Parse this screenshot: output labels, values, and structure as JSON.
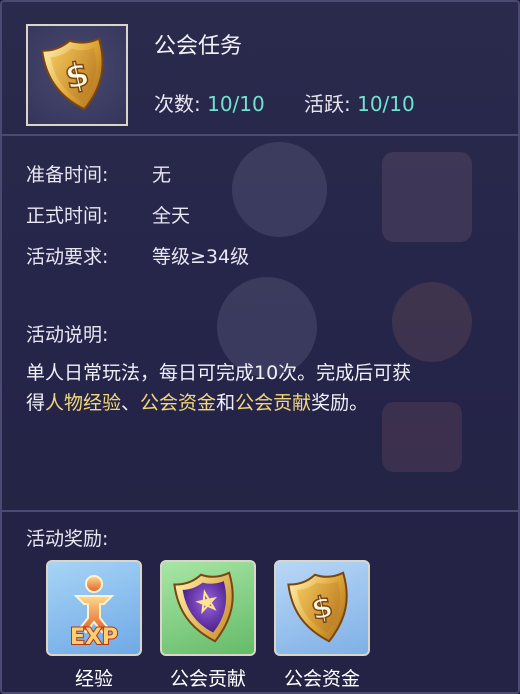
{
  "task": {
    "title": "公会任务",
    "count_label": "次数:",
    "count_value": "10/10",
    "active_label": "活跃:",
    "active_value": "10/10",
    "icon": "guild-shield-dollar-icon"
  },
  "info": {
    "prep_label": "准备时间:",
    "prep_value": "无",
    "formal_label": "正式时间:",
    "formal_value": "全天",
    "req_label": "活动要求:",
    "req_value": "等级≥34级"
  },
  "description": {
    "label": "活动说明:",
    "line1": "单人日常玩法，每日可完成10次。完成后可获",
    "line2_prefix": "得",
    "hl1": "人物经验",
    "sep1": "、",
    "hl2": "公会资金",
    "sep2": "和",
    "hl3": "公会贡献",
    "suffix": "奖励。"
  },
  "rewards": {
    "label": "活动奖励:",
    "items": [
      {
        "name": "经验",
        "icon": "exp-icon"
      },
      {
        "name": "公会贡献",
        "icon": "guild-contribution-icon"
      },
      {
        "name": "公会资金",
        "icon": "guild-funds-icon"
      }
    ]
  },
  "colors": {
    "highlight": "#f2d77a",
    "value": "#6fe3cf"
  }
}
